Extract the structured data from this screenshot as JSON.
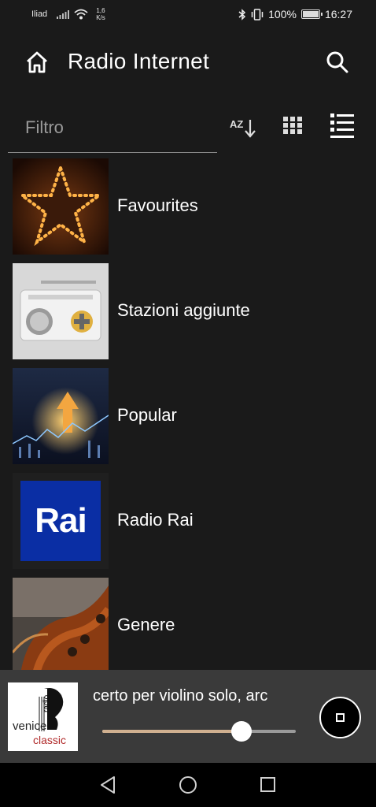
{
  "status_bar": {
    "carrier": "Iliad",
    "speed_value": "1,6",
    "speed_unit": "K/s",
    "battery": "100%",
    "time": "16:27"
  },
  "app_bar": {
    "title": "Radio Internet"
  },
  "filter": {
    "placeholder": "Filtro",
    "sort_label": "AZ"
  },
  "list": {
    "items": [
      {
        "label": "Favourites",
        "icon": "star-lights-image"
      },
      {
        "label": "Stazioni aggiunte",
        "icon": "radio-plus-image"
      },
      {
        "label": "Popular",
        "icon": "trend-arrow-image"
      },
      {
        "label": "Radio Rai",
        "icon": "rai-logo-image",
        "logo_text": "Rai"
      },
      {
        "label": "Genere",
        "icon": "violin-image"
      }
    ]
  },
  "player": {
    "track_title": "certo per violino solo, arc",
    "station_logo_text": [
      "radio",
      "venice",
      "classic"
    ],
    "volume_fraction": 0.72
  },
  "colors": {
    "background": "#1a1a1a",
    "player_background": "#3a3a3a",
    "rai_blue": "#0a2ea4",
    "volume_fill": "#d0b090"
  }
}
